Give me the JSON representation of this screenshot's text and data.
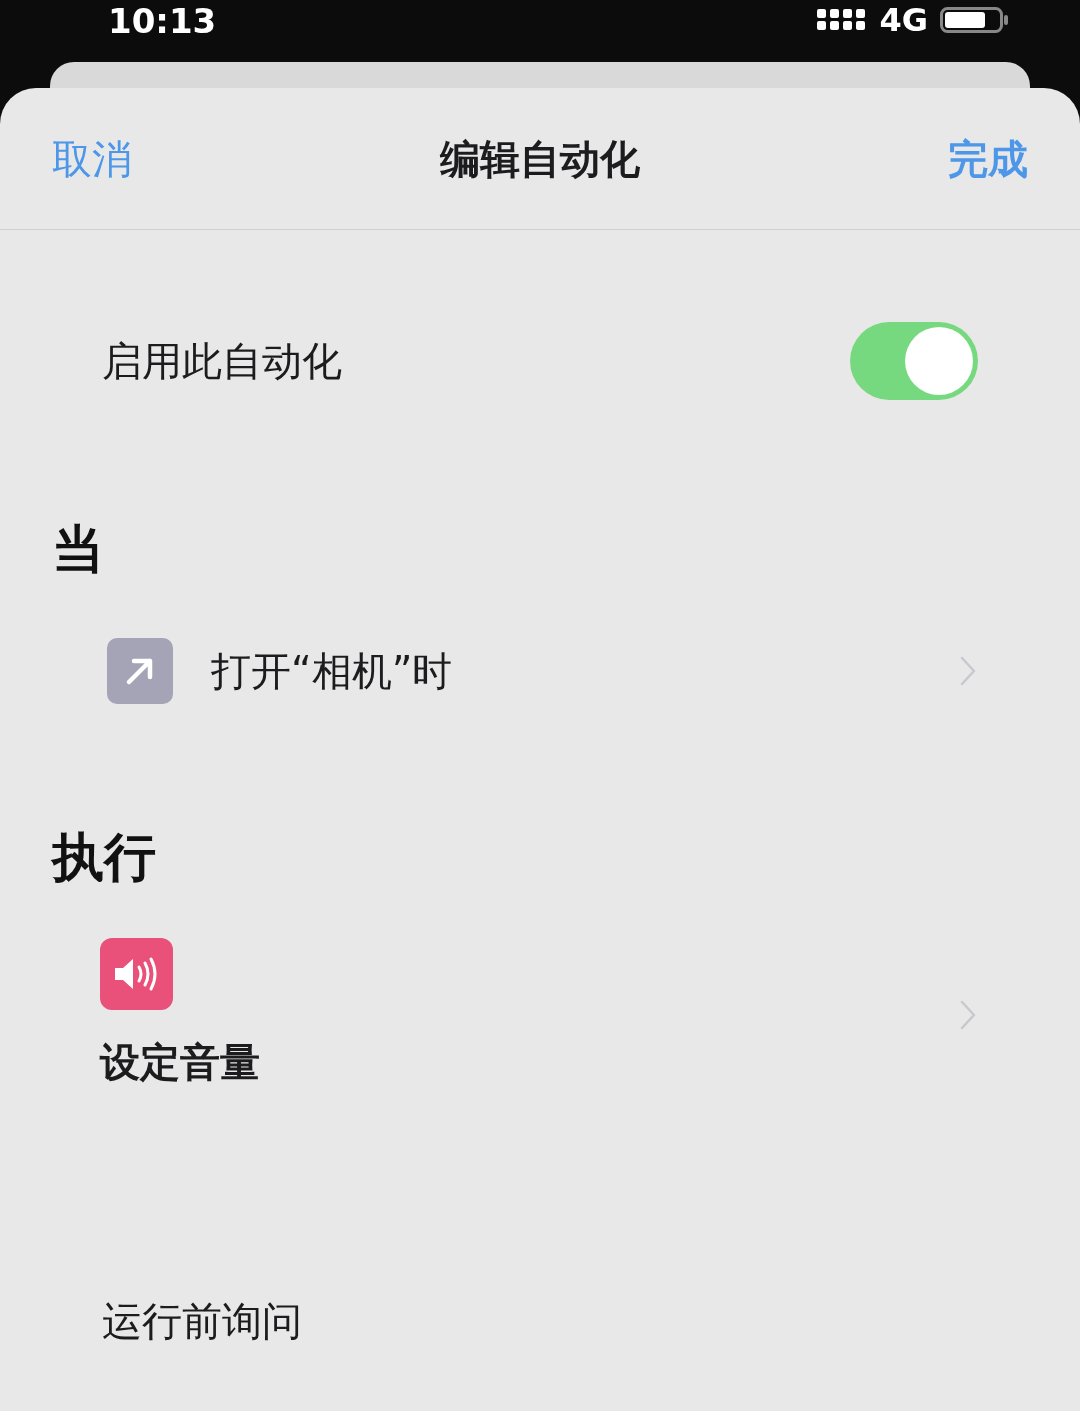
{
  "status_bar": {
    "time": "10:13",
    "network": "4G"
  },
  "nav": {
    "cancel": "取消",
    "title": "编辑自动化",
    "done": "完成"
  },
  "enable": {
    "label": "启用此自动化",
    "on": true
  },
  "sections": [
    {
      "heading": "当",
      "items": [
        {
          "kind": "trigger",
          "label": "打开“相机”时"
        }
      ]
    },
    {
      "heading": "执行",
      "items": [
        {
          "kind": "action",
          "label": "设定音量"
        }
      ]
    }
  ],
  "ask_before_run": {
    "label": "运行前询问"
  }
}
